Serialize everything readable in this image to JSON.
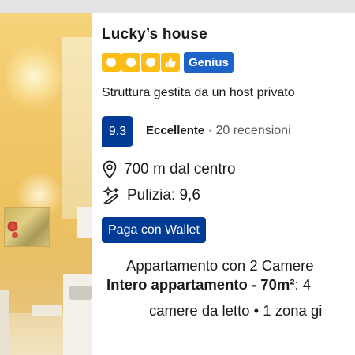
{
  "property": {
    "name": "Lucky’s house",
    "quality_squares": 4,
    "genius_label": "Genius",
    "host_text": "Struttura gestita da un host privato"
  },
  "review": {
    "score": "9.3",
    "label": "Eccellente",
    "separator": "·",
    "count_text": "20 recensioni"
  },
  "details": {
    "distance": "700 m dal centro",
    "cleanliness": "Pulizia: 9,6"
  },
  "wallet_button": "Paga con Wallet",
  "apartment": {
    "type_line": "Appartamento con 2 Camere",
    "summary_bold": "Intero appartamento - 70m²",
    "summary_rest": ": 4",
    "rooms_line": "camere da letto • 1 zona gi"
  },
  "colors": {
    "accent_blue": "#003b95",
    "genius_blue": "#1b63c6",
    "rating_yellow": "#fcbd16"
  }
}
